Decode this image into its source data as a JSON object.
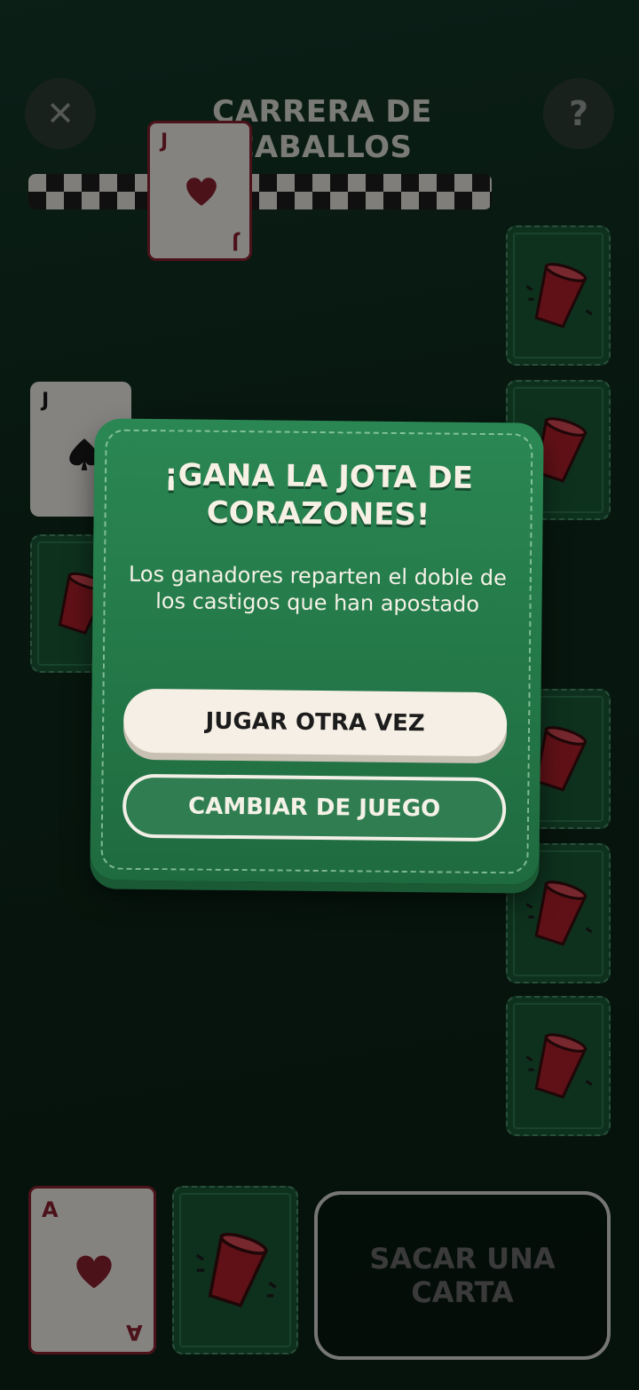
{
  "header": {
    "close_icon": "✕",
    "title": "CARRERA DE CABALLOS",
    "help_icon": "?"
  },
  "race": {
    "leader_card": {
      "rank": "J",
      "suit": "heart",
      "color": "#8a2230"
    },
    "left_card": {
      "rank": "J",
      "suit": "spade",
      "color": "#1a1a1a"
    }
  },
  "bottom": {
    "drawn_card": {
      "rank": "A",
      "suit": "heart",
      "color": "#8a2230"
    },
    "draw_button_label": "SACAR UNA CARTA"
  },
  "modal": {
    "title": "¡GANA LA JOTA DE CORAZONES!",
    "message": "Los ganadores reparten el doble de los castigos que han apostado",
    "play_again_label": "JUGAR OTRA VEZ",
    "change_game_label": "CAMBIAR DE JUEGO"
  },
  "colors": {
    "table_green": "#1a5a35",
    "cup_red": "#b01f2a",
    "modal_green": "#247a4a"
  }
}
